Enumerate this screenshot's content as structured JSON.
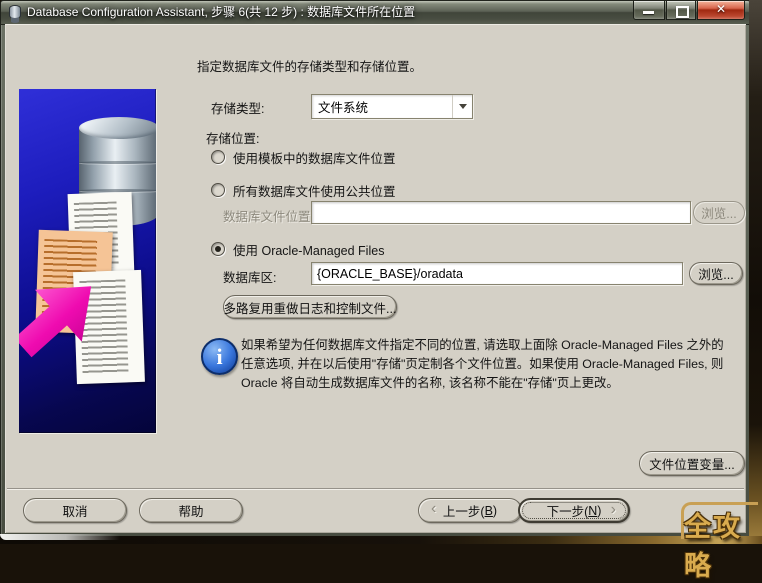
{
  "window": {
    "title": "Database Configuration Assistant, 步骤 6(共 12 步) : 数据库文件所在位置",
    "controls": {
      "close_glyph": "✕"
    }
  },
  "content": {
    "instruction": "指定数据库文件的存储类型和存储位置。",
    "storage_type": {
      "label": "存储类型:",
      "value": "文件系统"
    },
    "storage_location_label": "存储位置:",
    "options": [
      {
        "label": "使用模板中的数据库文件位置",
        "selected": false
      },
      {
        "label": "所有数据库文件使用公共位置",
        "selected": false
      },
      {
        "label": "使用 Oracle-Managed Files",
        "selected": true
      }
    ],
    "db_file_location": {
      "label": "数据库文件位置:",
      "value": "",
      "browse_label": "浏览...",
      "enabled": false
    },
    "db_area": {
      "label": "数据库区:",
      "value": "{ORACLE_BASE}/oradata",
      "browse_label": "浏览...",
      "enabled": true
    },
    "multiplex_button_label": "多路复用重做日志和控制文件...",
    "info_text": "如果希望为任何数据库文件指定不同的位置, 请选取上面除 Oracle-Managed Files 之外的任意选项, 并在以后使用\"存储\"页定制各个文件位置。如果使用 Oracle-Managed Files, 则 Oracle 将自动生成数据库文件的名称, 该名称不能在\"存储\"页上更改。",
    "file_location_vars_label": "文件位置变量..."
  },
  "footer": {
    "cancel_label": "取消",
    "help_label": "帮助",
    "back": {
      "pre": "上一步(",
      "key": "B",
      "post": ")",
      "chevron": "‹"
    },
    "next": {
      "pre": "下一步(",
      "key": "N",
      "post": ")",
      "chevron": "›"
    }
  },
  "icons": {
    "info": "i"
  },
  "watermark": "全攻略",
  "colors": {
    "dialog_bg": "#d4d0c6",
    "panel_blue": "#1414a8",
    "accent_arrow": "#ef0bb0",
    "info_blue": "#2a6cd8",
    "close_red": "#b02c14",
    "watermark_gold": "#d9ab4e"
  }
}
